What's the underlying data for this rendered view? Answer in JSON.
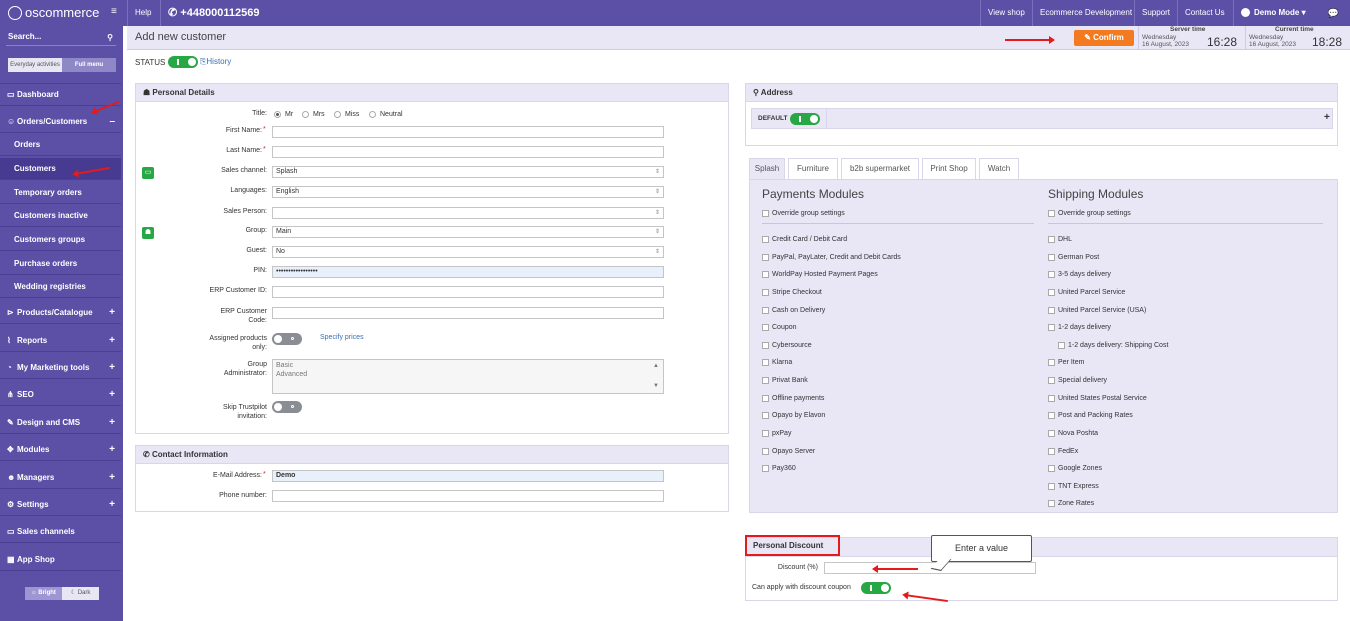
{
  "topbar": {
    "logo": "oscommerce",
    "help": "Help",
    "phone": "+448000112569",
    "view_shop": "View shop",
    "ecommerce_dev": "Ecommerce Development",
    "support": "Support",
    "contact_us": "Contact Us",
    "demo_mode": "Demo Mode"
  },
  "sidebar": {
    "search": "Search...",
    "tab_everyday": "Everyday activities",
    "tab_full": "Full menu",
    "items": [
      {
        "label": "Dashboard"
      },
      {
        "label": "Orders/Customers"
      },
      {
        "label": "Orders"
      },
      {
        "label": "Customers"
      },
      {
        "label": "Temporary orders"
      },
      {
        "label": "Customers inactive"
      },
      {
        "label": "Customers groups"
      },
      {
        "label": "Purchase orders"
      },
      {
        "label": "Wedding registries"
      },
      {
        "label": "Products/Catalogue"
      },
      {
        "label": "Reports"
      },
      {
        "label": "My Marketing tools"
      },
      {
        "label": "SEO"
      },
      {
        "label": "Design and CMS"
      },
      {
        "label": "Modules"
      },
      {
        "label": "Managers"
      },
      {
        "label": "Settings"
      },
      {
        "label": "Sales channels"
      },
      {
        "label": "App Shop"
      }
    ],
    "bright": "Bright",
    "dark": "Dark"
  },
  "header": {
    "title": "Add new customer",
    "confirm": "Confirm",
    "server_time_label": "Server time",
    "current_time_label": "Current time",
    "server_day": "Wednesday",
    "server_date": "16 August, 2023",
    "server_time": "16:28",
    "current_day": "Wednesday",
    "current_date": "16 August, 2023",
    "current_time": "18:28"
  },
  "status": {
    "label": "STATUS",
    "history": "History"
  },
  "personal": {
    "title": "Personal Details",
    "title_label": "Title:",
    "title_options": [
      "Mr",
      "Mrs",
      "Miss",
      "Neutral"
    ],
    "first_name": "First Name:",
    "last_name": "Last Name:",
    "sales_channel": "Sales channel:",
    "sales_channel_value": "Splash",
    "languages": "Languages:",
    "languages_value": "English",
    "sales_person": "Sales Person:",
    "group": "Group:",
    "group_value": "Main",
    "guest": "Guest:",
    "guest_value": "No",
    "pin": "PIN:",
    "pin_value": "•••••••••••••••••",
    "erp_id": "ERP Customer ID:",
    "erp_code_1": "ERP Customer",
    "erp_code_2": "Code:",
    "assigned_1": "Assigned products",
    "assigned_2": "only:",
    "specify_prices": "Specify prices",
    "group_admin_1": "Group",
    "group_admin_2": "Administrator:",
    "group_admin_options": [
      "Basic",
      "Advanced"
    ],
    "trustpilot_1": "Skip Trustpilot",
    "trustpilot_2": "invitation:"
  },
  "contact": {
    "title": "Contact Information",
    "email": "E-Mail Address:",
    "email_value": "Demo",
    "phone": "Phone number:"
  },
  "address": {
    "title": "Address",
    "default": "DEFAULT",
    "plus": "+"
  },
  "shop_tabs": [
    "Splash",
    "Furniture",
    "b2b supermarket",
    "Print Shop",
    "Watch"
  ],
  "payments": {
    "title": "Payments Modules",
    "override": "Override group settings",
    "items": [
      "Credit Card / Debit Card",
      "PayPal, PayLater, Credit and Debit Cards",
      "WorldPay Hosted Payment Pages",
      "Stripe Checkout",
      "Cash on Delivery",
      "Coupon",
      "Cybersource",
      "Klarna",
      "Privat Bank",
      "Offline payments",
      "Opayo by Elavon",
      "pxPay",
      "Opayo Server",
      "Pay360"
    ]
  },
  "shipping": {
    "title": "Shipping Modules",
    "override": "Override group settings",
    "items": [
      "DHL",
      "German Post",
      "3-5 days delivery",
      "United Parcel Service",
      "United Parcel Service (USA)",
      "1-2 days delivery",
      "1-2 days delivery: Shipping Cost",
      "Per Item",
      "Special delivery",
      "United States Postal Service",
      "Post and Packing Rates",
      "Nova Poshta",
      "FedEx",
      "Google Zones",
      "TNT Express",
      "Zone Rates"
    ]
  },
  "discount": {
    "title": "Personal Discount",
    "discount_label": "Discount (%)",
    "coupon_label": "Can apply with discount coupon",
    "callout": "Enter a value"
  }
}
